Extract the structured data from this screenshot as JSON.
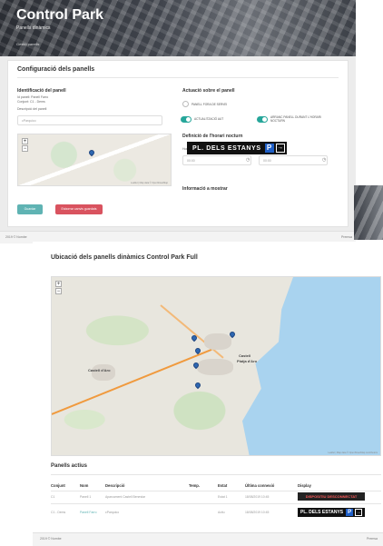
{
  "app": {
    "title": "Control Park",
    "subtitle": "Panells dinàmics",
    "breadcrumb": "Gestió panells"
  },
  "config": {
    "card_title": "Configuració dels panells",
    "ident_title": "Identificació del panell",
    "panel_name_line": "Id panell: Panell Farro",
    "conjunt_line": "Conjunt: C1 - Dems",
    "description_label": "Descripció del panell",
    "description_value": "cParquico",
    "actuacio_title": "Actuació sobre el panell",
    "option_off": "PANELL FORA DE SERVEI",
    "option_auto": "ACTUALITZACIÓ AUT",
    "option_info": "ARRANC PANELL DURANT L'HORARI NOCTURN",
    "horari_title": "Definició de l'horari nocturn",
    "start_label": "Hora inici",
    "start_value": "00:00",
    "end_label": "Hora final",
    "end_value": "00:00",
    "info_title": "Informació a mostrar",
    "sign_text": "PL. DELS ESTANYS",
    "sign_p": "P",
    "sign_arrow": "→",
    "save_button": "Guardar",
    "delete_button": "Esborrar canvis guardats",
    "map_attr": "Leaflet | Map data © OpenStreetMap"
  },
  "footer": {
    "left": "2019 © Nombe",
    "right": "Premsa"
  },
  "locations": {
    "title": "Ubicació dels panells dinàmics Control Park Full",
    "labels": {
      "castell": "Castell",
      "platja": "Platja d'Aro",
      "aro": "Castell d'Aro"
    },
    "map_attr": "Leaflet | Map data © OpenStreetMap contributors"
  },
  "active": {
    "title": "Panells actius",
    "headers": [
      "Conjunt",
      "Nom",
      "Descripció",
      "Temp.",
      "Estat",
      "Última connexió",
      "Display"
    ],
    "rows": [
      {
        "conjunt": "C1",
        "nom": "Panell 1",
        "descripcio": "Aparcament Castell Benestar",
        "temp": "",
        "estat": "Estat 1",
        "ultima": "18/08/2019 10:45",
        "display": "DISPOSITIU DESCONNECTAT"
      },
      {
        "conjunt": "C1 - Dems",
        "nom": "Panell Farro",
        "descripcio": "cParquico",
        "temp": "",
        "estat": "Actiu",
        "ultima": "18/08/2019 10:45",
        "display": "PL. DELS ESTANYS"
      }
    ],
    "mini_p": "P",
    "mini_arrow": "→"
  },
  "colors": {
    "accent": "#5fb3b3",
    "danger": "#d9535f",
    "sign_blue": "#1f5fc7",
    "sea": "#a9d3ef"
  }
}
